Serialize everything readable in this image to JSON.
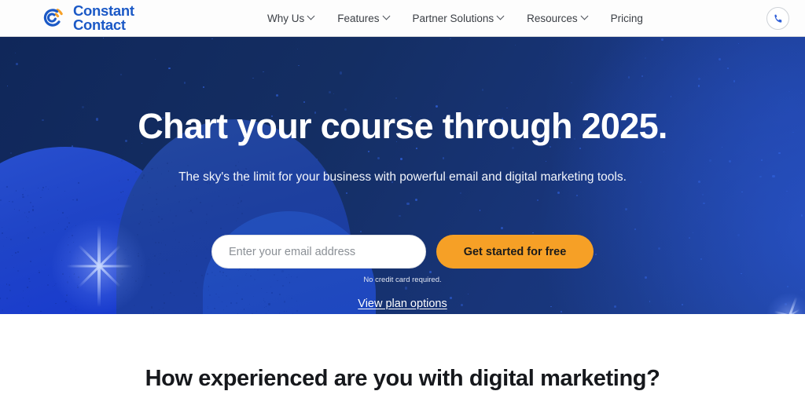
{
  "header": {
    "logo": {
      "icon": "constant-contact-swirl-icon",
      "line1": "Constant",
      "line2": "Contact",
      "color": "#1b59c6",
      "accent": "#f6a026"
    },
    "nav": [
      {
        "label": "Why Us",
        "has_dropdown": true
      },
      {
        "label": "Features",
        "has_dropdown": true
      },
      {
        "label": "Partner Solutions",
        "has_dropdown": true
      },
      {
        "label": "Resources",
        "has_dropdown": true
      },
      {
        "label": "Pricing",
        "has_dropdown": false
      }
    ],
    "phone_button": {
      "icon": "phone-icon",
      "label": "Call us"
    }
  },
  "hero": {
    "headline": "Chart your course through 2025.",
    "subhead": "The sky's the limit for your business with powerful email and digital marketing tools.",
    "email_placeholder": "Enter your email address",
    "email_value": "",
    "cta_label": "Get started for free",
    "fineprint": "No credit card required.",
    "plan_link": "View plan options",
    "colors": {
      "bg_dark": "#142e63",
      "bg_light": "#1a3a86",
      "cta": "#f6a026",
      "cloud_bright": "#1f44c7",
      "cloud_mid": "#1d3f9f",
      "star": "#2f5fd8"
    }
  },
  "lower": {
    "section_title": "How experienced are you with digital marketing?"
  }
}
